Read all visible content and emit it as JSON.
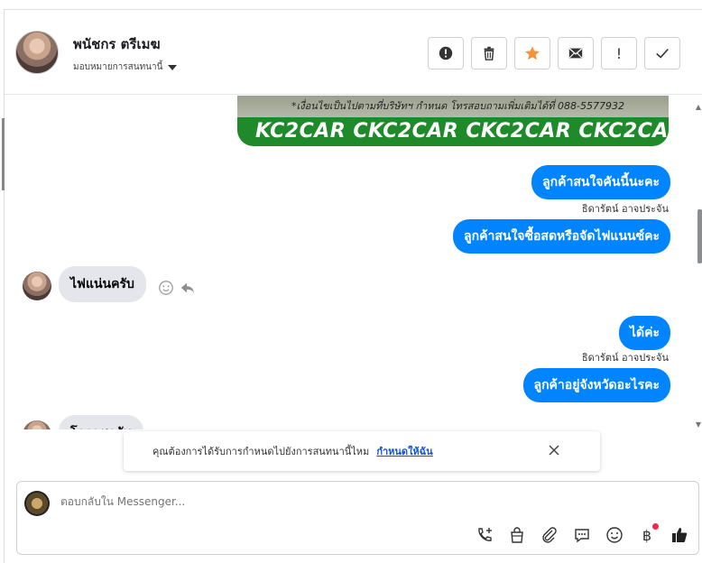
{
  "header": {
    "contact_name": "พนัชกร ตรีเมฆ",
    "assign_label": "มอบหมายการสนทนานี้",
    "actions": [
      {
        "name": "spam-icon",
        "label": ""
      },
      {
        "name": "trash-icon",
        "label": ""
      },
      {
        "name": "star-icon",
        "label": ""
      },
      {
        "name": "mail-icon",
        "label": ""
      },
      {
        "name": "exclamation-icon",
        "label": "!"
      },
      {
        "name": "check-icon",
        "label": ""
      }
    ]
  },
  "messages": {
    "image_phone_text": "*เงื่อนไขเป็นไปตามที่บริษัทฯ กำหนด โทรสอบถามเพิ่มเติมได้ที่ 088-5577932",
    "image_band_text": "KC2CAR CKC2CAR CKC2CAR CKC2CAR CKC2",
    "out1": "ลูกค้าสนใจคันนี้นะคะ",
    "sender1": "ธิดารัตน์ อาจประจัน",
    "out2": "ลูกค้าสนใจซื้อสดหรือจัดไฟแนนซ์คะ",
    "in1": "ไฟแน่นครับ",
    "out3": "ได้ค่ะ",
    "sender2": "ธิดารัตน์ อาจประจัน",
    "out4": "ลูกค้าอยู่จังหวัดอะไรคะ",
    "in2": "โคราชครับ"
  },
  "notice": {
    "text": "คุณต้องการได้รับการกำหนดไปยังการสนทนานี้ไหม",
    "link": "กำหนดให้ฉัน"
  },
  "composer": {
    "placeholder": "ตอบกลับใน Messenger...",
    "baht_symbol": "฿"
  },
  "colors": {
    "accent": "#0084ff",
    "star": "#f5933b",
    "incoming_bg": "#e4e6eb"
  }
}
